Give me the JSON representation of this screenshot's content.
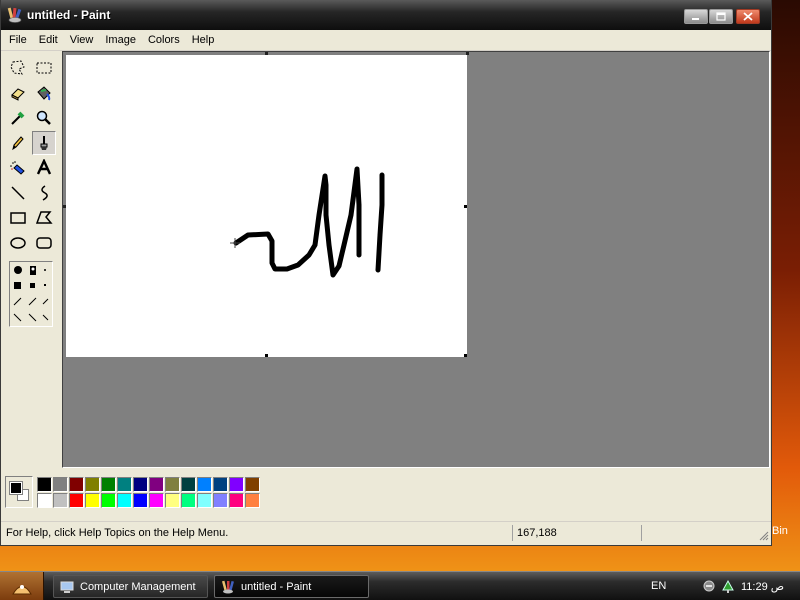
{
  "window": {
    "title": "untitled - Paint",
    "controls": {
      "minimize": "minimize",
      "maximize": "maximize",
      "close": "close"
    }
  },
  "menu": [
    "File",
    "Edit",
    "View",
    "Image",
    "Colors",
    "Help"
  ],
  "tools": [
    {
      "name": "free-form-select-icon"
    },
    {
      "name": "select-icon"
    },
    {
      "name": "eraser-icon"
    },
    {
      "name": "fill-with-color-icon"
    },
    {
      "name": "pick-color-icon"
    },
    {
      "name": "magnifier-icon"
    },
    {
      "name": "pencil-icon"
    },
    {
      "name": "brush-icon",
      "active": true
    },
    {
      "name": "airbrush-icon"
    },
    {
      "name": "text-icon"
    },
    {
      "name": "line-icon"
    },
    {
      "name": "curve-icon"
    },
    {
      "name": "rectangle-icon"
    },
    {
      "name": "polygon-icon"
    },
    {
      "name": "ellipse-icon"
    },
    {
      "name": "rounded-rectangle-icon"
    }
  ],
  "palette": {
    "foreground": "#000000",
    "background": "#ffffff",
    "top_row": [
      "#000000",
      "#808080",
      "#800000",
      "#808000",
      "#008000",
      "#008080",
      "#000080",
      "#800080",
      "#808040",
      "#004040",
      "#0080ff",
      "#004080",
      "#8000ff",
      "#804000"
    ],
    "bottom_row": [
      "#ffffff",
      "#c0c0c0",
      "#ff0000",
      "#ffff00",
      "#00ff00",
      "#00ffff",
      "#0000ff",
      "#ff00ff",
      "#ffff80",
      "#00ff80",
      "#80ffff",
      "#8080ff",
      "#ff0080",
      "#ff8040"
    ]
  },
  "status": {
    "help_text": "For Help, click Help Topics on the Help Menu.",
    "coords": "167,188"
  },
  "side_label": "Bin",
  "taskbar": {
    "tasks": [
      {
        "label": "Computer Management",
        "icon": "computer-management-icon"
      },
      {
        "label": "untitled - Paint",
        "icon": "paint-icon",
        "active": true
      }
    ],
    "language": "EN",
    "clock": "11:29 ص"
  }
}
